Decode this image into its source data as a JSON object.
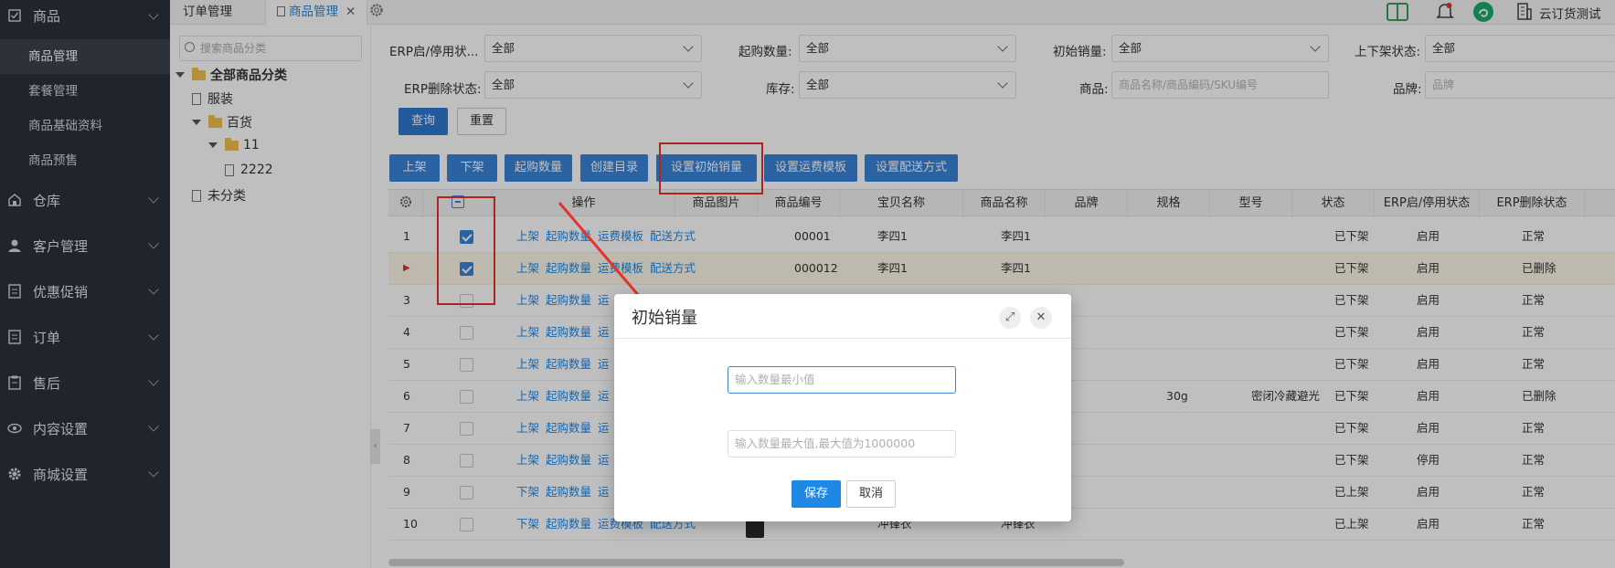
{
  "sidebar": {
    "groups": [
      {
        "label": "商品",
        "sub": [
          "商品管理",
          "套餐管理",
          "商品基础资料",
          "商品预售"
        ]
      },
      {
        "label": "仓库"
      },
      {
        "label": "客户管理"
      },
      {
        "label": "优惠促销"
      },
      {
        "label": "订单"
      },
      {
        "label": "售后"
      },
      {
        "label": "内容设置"
      },
      {
        "label": "商城设置"
      }
    ]
  },
  "tabs": {
    "t1": "订单管理",
    "t2": "商品管理"
  },
  "header": {
    "user": "云订货测试"
  },
  "tree": {
    "search_placeholder": "搜索商品分类",
    "root": "全部商品分类",
    "n1": "服装",
    "n2": "百货",
    "n3": "11",
    "n4": "2222",
    "n5": "未分类"
  },
  "filters": {
    "erp_status_label": "ERP启/停用状...",
    "erp_status_value": "全部",
    "min_qty_label": "起购数量:",
    "min_qty_value": "全部",
    "init_sales_label": "初始销量:",
    "init_sales_value": "全部",
    "shelf_label": "上下架状态:",
    "shelf_value": "全部",
    "erp_del_label": "ERP删除状态:",
    "erp_del_value": "全部",
    "stock_label": "库存:",
    "stock_value": "全部",
    "goods_label": "商品:",
    "goods_placeholder": "商品名称/商品编码/SKU编号",
    "brand_label": "品牌:",
    "brand_placeholder": "品牌"
  },
  "actions": {
    "query": "查询",
    "reset": "重置"
  },
  "toolbar": [
    "上架",
    "下架",
    "起购数量",
    "创建目录",
    "设置初始销量",
    "设置运费模板",
    "设置配送方式"
  ],
  "columns": [
    "操作",
    "商品图片",
    "商品编号",
    "宝贝名称",
    "商品名称",
    "品牌",
    "规格",
    "型号",
    "状态",
    "ERP启/停用状态",
    "ERP删除状态"
  ],
  "rows": [
    {
      "idx": "1",
      "op1": "上架",
      "op2": "起购数量",
      "op3": "运费模板",
      "op4": "配送方式",
      "code": "00001",
      "bname": "李四1",
      "gname": "李四1",
      "spec": "",
      "model": "",
      "status": "已下架",
      "erp": "启用",
      "del": "正常",
      "checked": true
    },
    {
      "idx": "▶",
      "op1": "上架",
      "op2": "起购数量",
      "op3": "运费模板",
      "op4": "配送方式",
      "code": "000012",
      "bname": "李四1",
      "gname": "李四1",
      "spec": "",
      "model": "",
      "status": "已下架",
      "erp": "启用",
      "del": "已删除",
      "checked": true
    },
    {
      "idx": "3",
      "op1": "上架",
      "op2": "起购数量",
      "op3": "运",
      "op4": "",
      "code": "",
      "bname": "",
      "gname": "",
      "spec": "",
      "model": "",
      "status": "已下架",
      "erp": "启用",
      "del": "正常",
      "checked": false
    },
    {
      "idx": "4",
      "op1": "上架",
      "op2": "起购数量",
      "op3": "运",
      "op4": "",
      "code": "",
      "bname": "",
      "gname": "",
      "spec": "",
      "model": "",
      "status": "已下架",
      "erp": "启用",
      "del": "正常",
      "checked": false
    },
    {
      "idx": "5",
      "op1": "上架",
      "op2": "起购数量",
      "op3": "运",
      "op4": "",
      "code": "",
      "bname": "",
      "gname": "",
      "spec": "",
      "model": "",
      "status": "已下架",
      "erp": "启用",
      "del": "正常",
      "checked": false
    },
    {
      "idx": "6",
      "op1": "上架",
      "op2": "起购数量",
      "op3": "运",
      "op4": "",
      "code": "",
      "bname": "",
      "gname": "",
      "spec": "30g",
      "model": "密闭冷藏避光",
      "status": "已下架",
      "erp": "启用",
      "del": "已删除",
      "checked": false
    },
    {
      "idx": "7",
      "op1": "上架",
      "op2": "起购数量",
      "op3": "运",
      "op4": "",
      "code": "",
      "bname": "",
      "gname": "",
      "spec": "",
      "model": "",
      "status": "已下架",
      "erp": "启用",
      "del": "正常",
      "checked": false
    },
    {
      "idx": "8",
      "op1": "上架",
      "op2": "起购数量",
      "op3": "运",
      "op4": "",
      "code": "",
      "bname": "",
      "gname": "",
      "spec": "",
      "model": "",
      "status": "已下架",
      "erp": "停用",
      "del": "正常",
      "checked": false
    },
    {
      "idx": "9",
      "op1": "下架",
      "op2": "起购数量",
      "op3": "运",
      "op4": "",
      "code": "",
      "bname": "",
      "gname": "",
      "spec": "",
      "model": "",
      "status": "已上架",
      "erp": "启用",
      "del": "正常",
      "checked": false
    },
    {
      "idx": "10",
      "op1": "下架",
      "op2": "起购数量",
      "op3": "运费模板",
      "op4": "配送方式",
      "code": "",
      "bname": "冲锋衣",
      "gname": "冲锋衣",
      "spec": "",
      "model": "",
      "status": "已上架",
      "erp": "启用",
      "del": "正常",
      "checked": false
    }
  ],
  "dialog": {
    "title": "初始销量",
    "min_placeholder": "输入数量最小值",
    "max_placeholder": "输入数量最大值,最大值为1000000",
    "save": "保存",
    "cancel": "取消"
  },
  "colors": {
    "accent": "#2f78d0",
    "annotation": "#e5332a",
    "sidebar": "#2b303b"
  }
}
